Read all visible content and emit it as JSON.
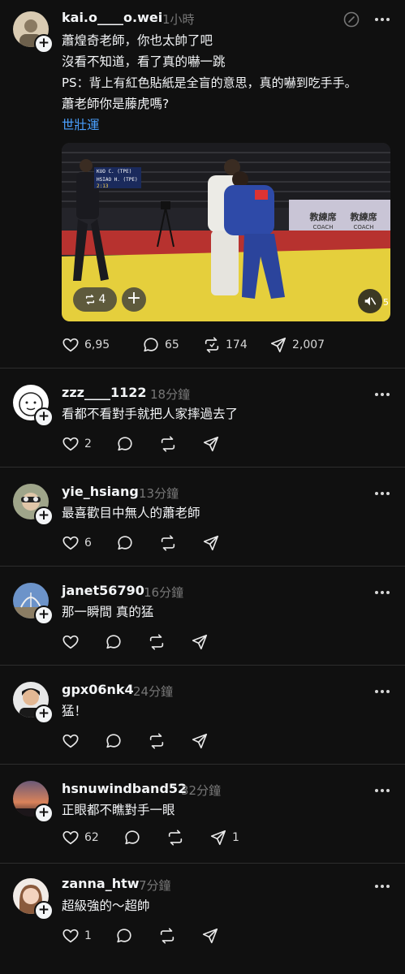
{
  "main_post": {
    "username": "kai.o____o.wei",
    "time": "1小時",
    "lines": [
      "蕭煌奇老師，你也太帥了吧",
      "沒看不知道，看了真的嚇一跳",
      "PS：背上有紅色貼紙是全盲的意思，真的嚇到吃手手。",
      "蕭老師你是藤虎嗎?"
    ],
    "topic": "世壯運",
    "video": {
      "repost_count": "4",
      "score_top": "KUO C. (TPE)",
      "score_bottom": "HSIAO H. (TPE)",
      "clock": "2:13",
      "sign1_cn": "教練席",
      "sign1_en": "COACH",
      "sign2_cn": "教練席",
      "sign2_en": "COACH",
      "badge_num": "5"
    },
    "likes": "6,95",
    "comments": "65",
    "reposts": "174",
    "shares": "2,007"
  },
  "replies": [
    {
      "username": "zzz____1122",
      "time": "18分鐘",
      "text": "看都不看對手就把人家摔過去了",
      "likes": "2",
      "reposts": "",
      "shares": ""
    },
    {
      "username": "yie_hsiang",
      "time": "13分鐘",
      "text": "最喜歡目中無人的蕭老師",
      "likes": "6",
      "reposts": "",
      "shares": ""
    },
    {
      "username": "janet56790",
      "time": "16分鐘",
      "text": "那一瞬間 真的猛",
      "likes": "",
      "reposts": "",
      "shares": ""
    },
    {
      "username": "gpx06nk4",
      "time": "24分鐘",
      "text": "猛！",
      "likes": "",
      "reposts": "",
      "shares": ""
    },
    {
      "username": "hsnuwindband52",
      "time": "32分鐘",
      "text": "正眼都不瞧對手一眼",
      "likes": "62",
      "reposts": "",
      "shares": "1"
    },
    {
      "username": "zanna_htw",
      "time": "7分鐘",
      "text": "超級強的～超帥",
      "likes": "1",
      "reposts": "",
      "shares": ""
    }
  ],
  "icons": {
    "like": "heart-icon",
    "comment": "comment-bubble-icon",
    "repost": "repost-icon",
    "share": "send-icon",
    "more": "more-dots-icon",
    "edit": "edit-circle-icon",
    "mute": "speaker-muted-icon"
  },
  "colors": {
    "background": "#101010",
    "topic_link": "#4aa0ff",
    "divider": "#2d2d2d"
  }
}
